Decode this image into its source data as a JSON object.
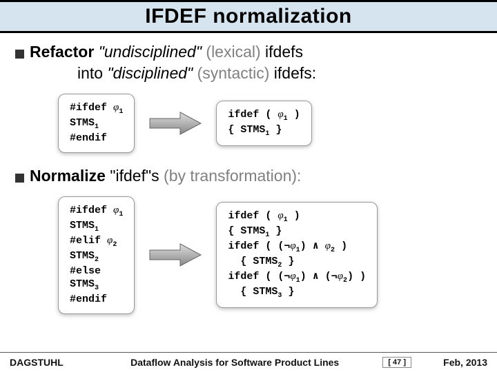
{
  "title": "IFDEF normalization",
  "bullet1": {
    "strong": "Refactor",
    "quoted1": "\"undisciplined\"",
    "paren1": "(lexical)",
    "tail1": "ifdefs",
    "line2a": "into",
    "quoted2": "\"disciplined\"",
    "paren2": "(syntactic)",
    "tail2": "ifdefs:"
  },
  "bullet2": {
    "strong": "Normalize",
    "quoted": "\"ifdef\"s",
    "tail": "(by transformation):"
  },
  "code": {
    "box1_l1a": "#ifdef ",
    "box1_l1b": "φ",
    "box1_l1c": "1",
    "box1_l2a": "STMS",
    "box1_l2b": "1",
    "box1_l3": "#endif",
    "box2_l1a": "ifdef ( ",
    "box2_l1b": "φ",
    "box2_l1c": "1",
    "box2_l1d": " )",
    "box2_l2a": "{ STMS",
    "box2_l2b": "1",
    "box2_l2c": " }",
    "box3_l1a": "#ifdef ",
    "box3_l1b": "φ",
    "box3_l1c": "1",
    "box3_l2a": "STMS",
    "box3_l2b": "1",
    "box3_l3a": "#elif ",
    "box3_l3b": "φ",
    "box3_l3c": "2",
    "box3_l4a": "STMS",
    "box3_l4b": "2",
    "box3_l5": "#else",
    "box3_l6a": "STMS",
    "box3_l6b": "3",
    "box3_l7": "#endif",
    "box4_l1a": "ifdef ( ",
    "box4_l1b": "φ",
    "box4_l1c": "1",
    "box4_l1d": " )",
    "box4_l2a": "{ STMS",
    "box4_l2b": "1",
    "box4_l2c": " }",
    "box4_l3a": "ifdef ( (¬",
    "box4_l3b": "φ",
    "box4_l3c": "1",
    "box4_l3d": ") ∧ ",
    "box4_l3e": "φ",
    "box4_l3f": "2",
    "box4_l3g": " )",
    "box4_l4a": "  { STMS",
    "box4_l4b": "2",
    "box4_l4c": " }",
    "box4_l5a": "ifdef ( (¬",
    "box4_l5b": "φ",
    "box4_l5c": "1",
    "box4_l5d": ") ∧ (¬",
    "box4_l5e": "φ",
    "box4_l5f": "2",
    "box4_l5g": ") )",
    "box4_l6a": "  { STMS",
    "box4_l6b": "3",
    "box4_l6c": " }"
  },
  "footer": {
    "left": "DAGSTUHL",
    "center": "Dataflow Analysis for Software Product Lines",
    "page": "[ 47 ]",
    "right": "Feb, 2013"
  }
}
